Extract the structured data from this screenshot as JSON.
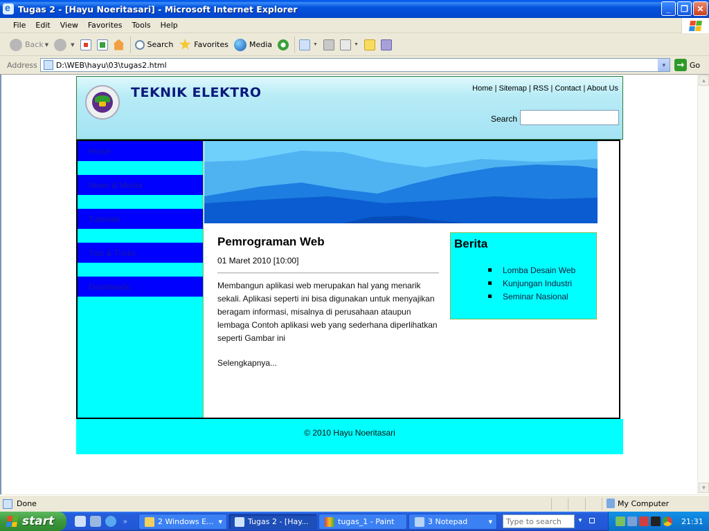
{
  "window": {
    "title": "Tugas 2 - [Hayu Noeritasari] - Microsoft Internet Explorer",
    "controls": [
      "minimize",
      "restore",
      "close"
    ]
  },
  "menubar": {
    "items": [
      "File",
      "Edit",
      "View",
      "Favorites",
      "Tools",
      "Help"
    ]
  },
  "toolbar": {
    "back_label": "Back",
    "search_label": "Search",
    "favorites_label": "Favorites",
    "media_label": "Media"
  },
  "addressbar": {
    "label": "Address",
    "value": "D:\\WEB\\hayu\\03\\tugas2.html",
    "go_label": "Go"
  },
  "page": {
    "header": {
      "site_title": "TEKNIK ELEKTRO",
      "top_links": [
        "Home",
        "Sitemap",
        "RSS",
        "Contact",
        "About Us"
      ],
      "link_separator": " | ",
      "search_label": "Search",
      "search_value": ""
    },
    "sidebar": {
      "items": [
        "Home",
        "News & Media",
        "Tutorials",
        "Tips & Tricks",
        "Downloads"
      ]
    },
    "article": {
      "title": "Pemrograman Web",
      "date": "01 Maret 2010 [10:00]",
      "body": "Membangun aplikasi web merupakan hal yang menarik sekali. Aplikasi seperti ini bisa digunakan untuk menyajikan beragam informasi, misalnya di perusahaan ataupun lembaga Contoh aplikasi web yang sederhana diperlihatkan seperti Gambar ini",
      "more_link": "Selengkapnya..."
    },
    "news": {
      "title": "Berita",
      "items": [
        "Lomba Desain Web",
        "Kunjungan Industri",
        "Seminar Nasional"
      ]
    },
    "footer": {
      "copyright": "© 2010 Hayu Noeritasari"
    },
    "colors": {
      "nav_item_bg": "#0000ff",
      "sidebar_bg": "#00ffff",
      "title_color": "#0a1a7a"
    }
  },
  "statusbar": {
    "status": "Done",
    "zone": "My Computer"
  },
  "taskbar": {
    "start_label": "start",
    "tasks": [
      {
        "label": "2 Windows E...",
        "icon": "folder-icon",
        "group": true
      },
      {
        "label": "Tugas 2 - [Hay...",
        "icon": "ie-icon",
        "active": true
      },
      {
        "label": "tugas_1 - Paint",
        "icon": "paint-icon"
      },
      {
        "label": "3 Notepad",
        "icon": "notepad-icon",
        "group": true
      }
    ],
    "search_placeholder": "Type to search",
    "clock": "21:31"
  }
}
